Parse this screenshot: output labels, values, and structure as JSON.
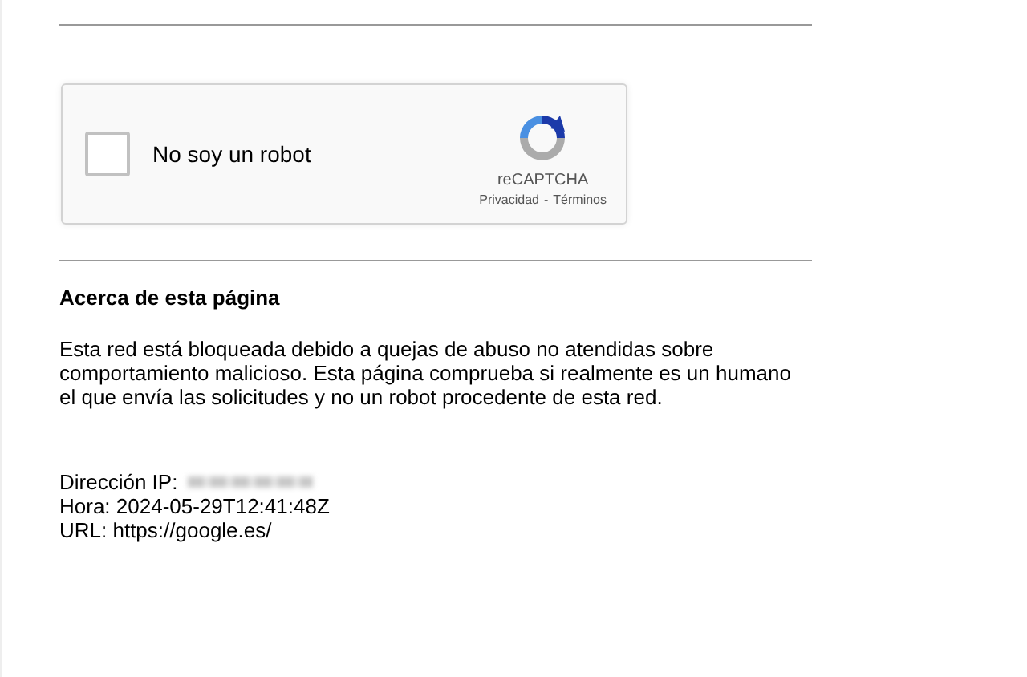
{
  "captcha": {
    "checked": false,
    "label": "No soy un robot",
    "brand": "reCAPTCHA",
    "links": [
      "Privacidad",
      "Términos"
    ],
    "separator": "-"
  },
  "about": {
    "heading": "Acerca de esta página",
    "paragraph": "Esta red está bloqueada debido a quejas de abuso no atendidas sobre comportamiento malicioso. Esta página comprueba si realmente es un humano el que envía las solicitudes y no un robot procedente de esta red."
  },
  "details": [
    {
      "kind": "redacted",
      "label": "Dirección IP:"
    },
    {
      "kind": "text",
      "label": "Hora: 2024-05-29T12:41:48Z"
    },
    {
      "kind": "text",
      "label": "URL: https://google.es/"
    }
  ]
}
